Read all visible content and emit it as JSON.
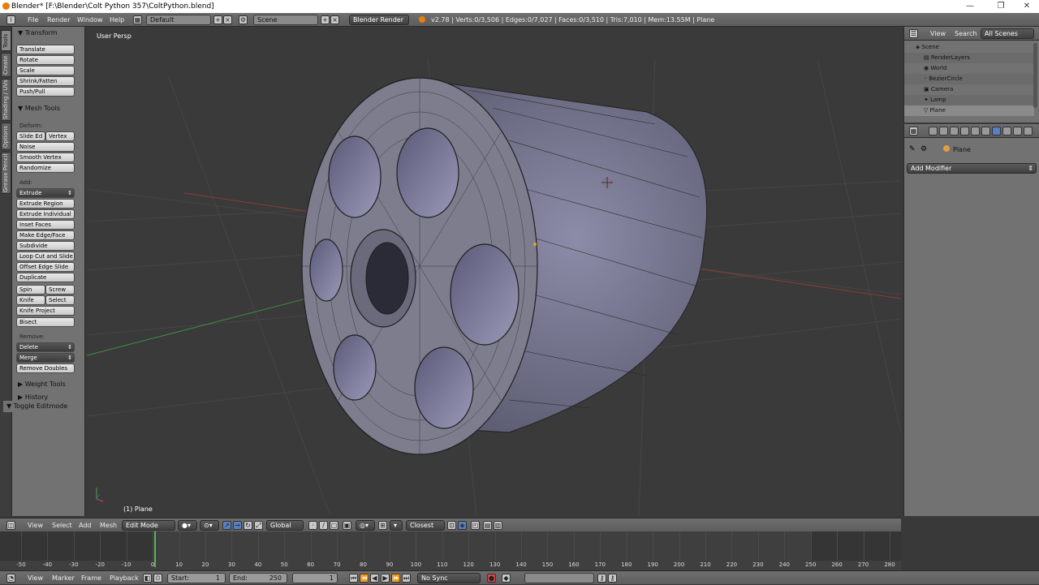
{
  "window": {
    "title": "Blender* [F:\\Blender\\Colt Python 357\\ColtPython.blend]",
    "minimize": "—",
    "maximize": "❐",
    "close": "✕"
  },
  "info_header": {
    "menus": [
      "File",
      "Render",
      "Window",
      "Help"
    ],
    "layout": "Default",
    "scene": "Scene",
    "engine": "Blender Render",
    "stats": "v2.78 | Verts:0/3,506 | Edges:0/7,027 | Faces:0/3,510 | Tris:7,010 | Mem:13.55M | Plane"
  },
  "tabs": [
    "Tools",
    "Create",
    "Shading / UVs",
    "Options",
    "Grease Pencil"
  ],
  "toolshelf": {
    "transform_header": "Transform",
    "transform": [
      "Translate",
      "Rotate",
      "Scale",
      "Shrink/Fatten",
      "Push/Pull"
    ],
    "mesh_tools_header": "Mesh Tools",
    "deform_label": "Deform:",
    "slide_edge": "Slide Ed",
    "vertex": "Vertex",
    "noise": "Noise",
    "smooth_vertex": "Smooth Vertex",
    "randomize": "Randomize",
    "add_label": "Add:",
    "extrude": "Extrude",
    "add_items": [
      "Extrude Region",
      "Extrude Individual",
      "Inset Faces",
      "Make Edge/Face",
      "Subdivide",
      "Loop Cut and Slide",
      "Offset Edge Slide",
      "Duplicate"
    ],
    "spin": "Spin",
    "screw": "Screw",
    "knife": "Knife",
    "select": "Select",
    "knife_project": "Knife Project",
    "bisect": "Bisect",
    "remove_label": "Remove:",
    "delete": "Delete",
    "merge": "Merge",
    "remove_doubles": "Remove Doubles",
    "weight_tools": "Weight Tools",
    "history": "History",
    "toggle_editmode": "Toggle Editmode"
  },
  "viewport": {
    "view_label": "User Persp",
    "object_label": "(1) Plane"
  },
  "outliner": {
    "view": "View",
    "search": "Search",
    "filter": "All Scenes",
    "items": [
      "Scene",
      "RenderLayers",
      "World",
      "BezierCircle",
      "Camera",
      "Lamp",
      "Plane"
    ]
  },
  "properties": {
    "object": "Plane",
    "add_modifier": "Add Modifier"
  },
  "viewport_header": {
    "view": "View",
    "select": "Select",
    "add": "Add",
    "mesh": "Mesh",
    "mode": "Edit Mode",
    "orientation": "Global",
    "snap": "Closest"
  },
  "timeline": {
    "ticks": [
      "-50",
      "-40",
      "-30",
      "-20",
      "-10",
      "0",
      "10",
      "20",
      "30",
      "40",
      "50",
      "60",
      "70",
      "80",
      "90",
      "100",
      "110",
      "120",
      "130",
      "140",
      "150",
      "160",
      "170",
      "180",
      "190",
      "200",
      "210",
      "220",
      "230",
      "240",
      "250",
      "260",
      "270",
      "280"
    ],
    "current_frame": "1",
    "start_label": "Start:",
    "start": "1",
    "end_label": "End:",
    "end": "250",
    "sync": "No Sync"
  },
  "timeline_header": {
    "view": "View",
    "marker": "Marker",
    "frame": "Frame",
    "playback": "Playback"
  }
}
